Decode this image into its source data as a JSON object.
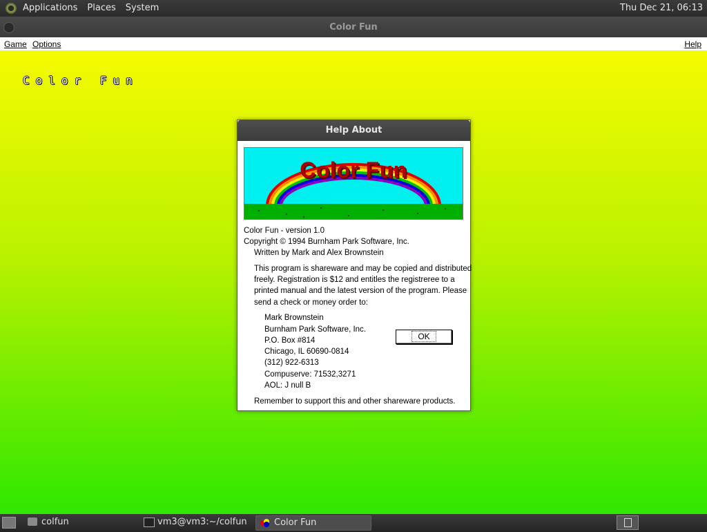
{
  "top_panel": {
    "menus": [
      "Applications",
      "Places",
      "System"
    ],
    "clock": "Thu Dec 21, 06:13"
  },
  "window": {
    "title": "Color Fun",
    "menubar": {
      "game": "Game",
      "options": "Options",
      "help": "Help"
    }
  },
  "game": {
    "title": "Color Fun"
  },
  "dialog": {
    "title": "Help About",
    "banner_text": "Color Fun",
    "version": "Color Fun - version 1.0",
    "copyright": "Copyright © 1994 Burnham Park Software, Inc.",
    "authors": "Written by Mark and Alex Brownstein",
    "paragraph": [
      "This program is shareware and may be copied and distributed",
      "freely. Registration is $12 and entitles the registreree to a",
      "printed manual and the latest version of the program. Please",
      "send a check or money order to:"
    ],
    "address": [
      "Mark Brownstein",
      "Burnham Park Software, Inc.",
      "P.O. Box #814",
      "Chicago, IL 60690-0814",
      "(312) 922-6313",
      "Compuserve: 71532,3271",
      "AOL: J null B"
    ],
    "footer": "Remember to support this and other shareware products.",
    "ok_label": "OK"
  },
  "taskbar": {
    "tasks": [
      "colfun",
      "vm3@vm3:~/colfun",
      "Color Fun"
    ]
  },
  "colors": {
    "gradient_top": "#f6fb00",
    "gradient_bottom": "#2ee800",
    "banner_bg": "#00f0f0",
    "banner_text": "#b00000"
  }
}
